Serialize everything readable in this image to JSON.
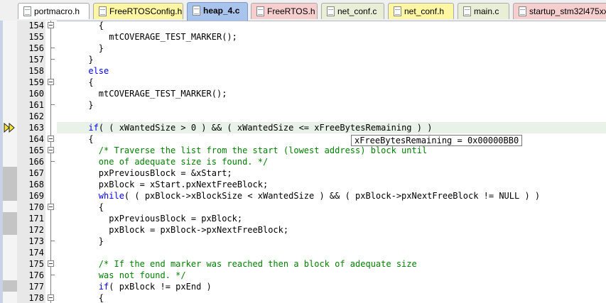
{
  "tabs": [
    {
      "label": "portmacro.h",
      "color": "#ffffff"
    },
    {
      "label": "FreeRTOSConfig.h",
      "color": "#fdf6a3"
    },
    {
      "label": "heap_4.c",
      "color": "#a8c4ec",
      "active": true
    },
    {
      "label": "FreeRTOS.h",
      "color": "#f6cece"
    },
    {
      "label": "net_conf.c",
      "color": "#e9efd6"
    },
    {
      "label": "net_conf.h",
      "color": "#fdf6a3"
    },
    {
      "label": "main.c",
      "color": "#e9efd6"
    },
    {
      "label": "startup_stm32l475xx",
      "color": "#f6cece"
    }
  ],
  "editor": {
    "current_line": "163",
    "tooltip": "xFreeBytesRemaining = 0x00000BB0",
    "colors": {
      "keyword": "#0000ff",
      "comment": "#008000",
      "current_line_bg": "#e8f2e8"
    },
    "lines": [
      {
        "n": "154",
        "fold": "box",
        "mark": false,
        "parts": [
          {
            "t": "        {"
          }
        ]
      },
      {
        "n": "155",
        "fold": "seg",
        "mark": false,
        "parts": [
          {
            "t": "          mtCOVERAGE_TEST_MARKER();"
          }
        ]
      },
      {
        "n": "156",
        "fold": "end",
        "mark": false,
        "parts": [
          {
            "t": "        }"
          }
        ]
      },
      {
        "n": "157",
        "fold": "end",
        "mark": false,
        "parts": [
          {
            "t": "      }"
          }
        ]
      },
      {
        "n": "158",
        "fold": "seg",
        "mark": false,
        "parts": [
          {
            "t": "      "
          },
          {
            "t": "else",
            "c": "kw"
          }
        ]
      },
      {
        "n": "159",
        "fold": "box",
        "mark": false,
        "parts": [
          {
            "t": "      {"
          }
        ]
      },
      {
        "n": "160",
        "fold": "seg",
        "mark": false,
        "parts": [
          {
            "t": "        mtCOVERAGE_TEST_MARKER();"
          }
        ]
      },
      {
        "n": "161",
        "fold": "end",
        "mark": false,
        "parts": [
          {
            "t": "      }"
          }
        ]
      },
      {
        "n": "162",
        "fold": "seg",
        "mark": false,
        "parts": [
          {
            "t": ""
          }
        ]
      },
      {
        "n": "163",
        "fold": "seg",
        "mark": false,
        "current": true,
        "parts": [
          {
            "t": "      "
          },
          {
            "t": "if",
            "c": "kw"
          },
          {
            "t": "( ( xWantedSize > 0 ) && ( xWantedSize <= xFreeBytesRemaining ) )"
          }
        ]
      },
      {
        "n": "164",
        "fold": "box",
        "mark": false,
        "parts": [
          {
            "t": "      {"
          }
        ]
      },
      {
        "n": "165",
        "fold": "box",
        "mark": false,
        "parts": [
          {
            "t": "        "
          },
          {
            "t": "/* Traverse the list from the start (lowest address) block until",
            "c": "cmt"
          }
        ]
      },
      {
        "n": "166",
        "fold": "end",
        "mark": false,
        "parts": [
          {
            "t": "        "
          },
          {
            "t": "one of adequate size is found. */",
            "c": "cmt"
          }
        ]
      },
      {
        "n": "167",
        "fold": "seg",
        "mark": true,
        "parts": [
          {
            "t": "        pxPreviousBlock = &xStart;"
          }
        ]
      },
      {
        "n": "168",
        "fold": "seg",
        "mark": true,
        "parts": [
          {
            "t": "        pxBlock = xStart.pxNextFreeBlock;"
          }
        ]
      },
      {
        "n": "169",
        "fold": "seg",
        "mark": true,
        "parts": [
          {
            "t": "        "
          },
          {
            "t": "while",
            "c": "kw"
          },
          {
            "t": "( ( pxBlock->xBlockSize < xWantedSize ) && ( pxBlock->pxNextFreeBlock != NULL ) )"
          }
        ]
      },
      {
        "n": "170",
        "fold": "box",
        "mark": false,
        "parts": [
          {
            "t": "        {"
          }
        ]
      },
      {
        "n": "171",
        "fold": "seg",
        "mark": true,
        "parts": [
          {
            "t": "          pxPreviousBlock = pxBlock;"
          }
        ]
      },
      {
        "n": "172",
        "fold": "seg",
        "mark": true,
        "parts": [
          {
            "t": "          pxBlock = pxBlock->pxNextFreeBlock;"
          }
        ]
      },
      {
        "n": "173",
        "fold": "end",
        "mark": false,
        "parts": [
          {
            "t": "        }"
          }
        ]
      },
      {
        "n": "174",
        "fold": "seg",
        "mark": false,
        "parts": [
          {
            "t": ""
          }
        ]
      },
      {
        "n": "175",
        "fold": "box",
        "mark": false,
        "parts": [
          {
            "t": "        "
          },
          {
            "t": "/* If the end marker was reached then a block of adequate size",
            "c": "cmt"
          }
        ]
      },
      {
        "n": "176",
        "fold": "end",
        "mark": false,
        "parts": [
          {
            "t": "        "
          },
          {
            "t": "was not found. */",
            "c": "cmt"
          }
        ]
      },
      {
        "n": "177",
        "fold": "seg",
        "mark": true,
        "parts": [
          {
            "t": "        "
          },
          {
            "t": "if",
            "c": "kw"
          },
          {
            "t": "( pxBlock != pxEnd )"
          }
        ]
      },
      {
        "n": "178",
        "fold": "box",
        "mark": false,
        "parts": [
          {
            "t": "        {"
          }
        ]
      }
    ]
  }
}
